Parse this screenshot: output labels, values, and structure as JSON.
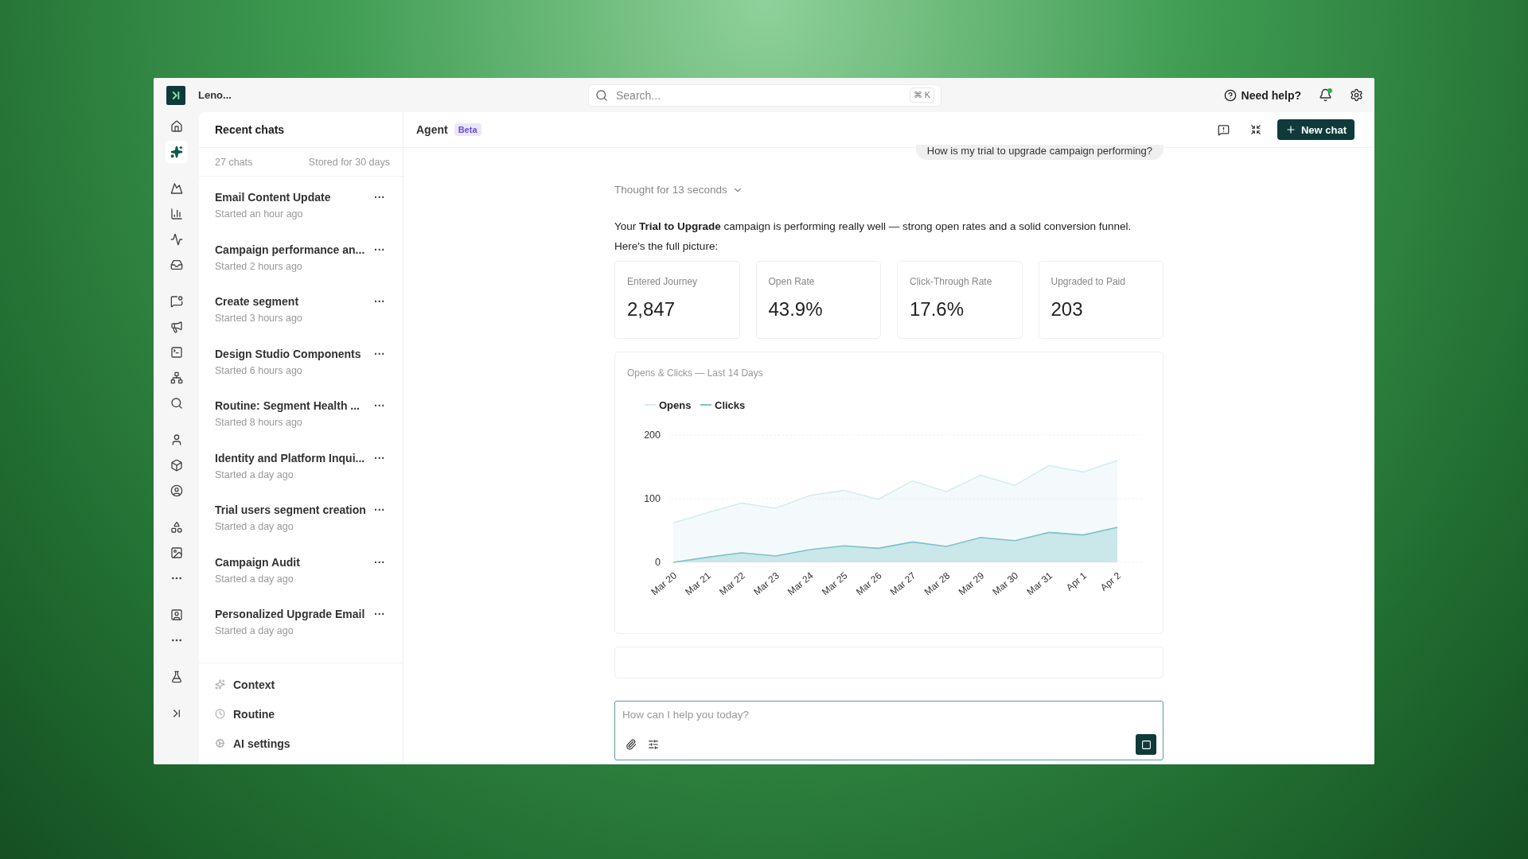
{
  "app": {
    "workspace": "Leno..."
  },
  "search": {
    "placeholder": "Search...",
    "shortcut": "⌘ K"
  },
  "header": {
    "help": "Need help?",
    "notification_dot": true
  },
  "rail": [
    {
      "selected": false
    },
    {
      "selected": true
    },
    {
      "selected": false
    },
    {
      "selected": false
    },
    {
      "selected": false
    },
    {
      "selected": false
    },
    {
      "selected": false
    },
    {
      "selected": false
    },
    {
      "selected": false
    },
    {
      "selected": false
    },
    {
      "selected": false
    },
    {
      "selected": false
    },
    {
      "selected": false
    },
    {
      "selected": false
    },
    {
      "selected": false
    },
    {
      "selected": false
    },
    {
      "selected": false
    },
    {
      "selected": false
    },
    {
      "selected": false
    },
    {
      "selected": false
    },
    {
      "selected": false
    }
  ],
  "recent_chats": {
    "title": "Recent chats",
    "count": "27 chats",
    "retention": "Stored for 30 days",
    "items": [
      {
        "title": "Email Content Update",
        "time": "Started an hour ago",
        "menu": "···"
      },
      {
        "title": "Campaign performance an...",
        "time": "Started 2 hours ago",
        "menu": "···"
      },
      {
        "title": "Create segment",
        "time": "Started 3 hours ago",
        "menu": "···"
      },
      {
        "title": "Design Studio Components",
        "time": "Started 6 hours ago",
        "menu": "···"
      },
      {
        "title": "Routine: Segment Health ...",
        "time": "Started 8 hours ago",
        "menu": "···"
      },
      {
        "title": "Identity and Platform Inqui...",
        "time": "Started a day ago",
        "menu": "···"
      },
      {
        "title": "Trial users segment creation",
        "time": "Started a day ago",
        "menu": "···"
      },
      {
        "title": "Campaign Audit",
        "time": "Started a day ago",
        "menu": "···"
      },
      {
        "title": "Personalized Upgrade Email",
        "time": "Started a day ago",
        "menu": "···"
      }
    ],
    "links": [
      {
        "kind": "context",
        "label": "Context"
      },
      {
        "kind": "routine",
        "label": "Routine"
      },
      {
        "kind": "settings",
        "label": "AI settings"
      }
    ]
  },
  "agent": {
    "title": "Agent",
    "badge": "Beta",
    "new_chat": "New chat"
  },
  "conversation": {
    "user_message": "How is my trial to upgrade campaign performing?",
    "thought": "Thought for 13 seconds",
    "answer": "Your **Trial to Upgrade** campaign is performing really well — strong open rates and a solid conversion funnel.",
    "answer_followup": "Here's the full picture:",
    "stats": [
      {
        "label": "Entered Journey",
        "value": "2,847"
      },
      {
        "label": "Open Rate",
        "value": "43.9%"
      },
      {
        "label": "Click-Through Rate",
        "value": "17.6%"
      },
      {
        "label": "Upgraded to Paid",
        "value": "203"
      }
    ],
    "chart": {
      "chart_data": {
        "type": "area",
        "title": "Opens & Clicks — Last 14 Days",
        "categories": [
          "Mar 20",
          "Mar 21",
          "Mar 22",
          "Mar 23",
          "Mar 24",
          "Mar 25",
          "Mar 26",
          "Mar 27",
          "Mar 28",
          "Mar 29",
          "Mar 30",
          "Mar 31",
          "Apr 1",
          "Apr 2"
        ],
        "series": [
          {
            "name": "Opens",
            "color": "#d3edf0",
            "values": [
              62,
              78,
              93,
              85,
              105,
              113,
              99,
              128,
              111,
              137,
              121,
              152,
              142,
              160
            ]
          },
          {
            "name": "Clicks",
            "color": "#7cc3c8",
            "values": [
              0,
              8,
              15,
              10,
              20,
              26,
              22,
              32,
              25,
              39,
              34,
              47,
              43,
              55
            ]
          }
        ],
        "ylim": [
          0,
          200
        ],
        "yticks": [
          0,
          100,
          200
        ],
        "legend": "top-left"
      }
    }
  },
  "composer": {
    "placeholder": "How can I help you today?"
  }
}
